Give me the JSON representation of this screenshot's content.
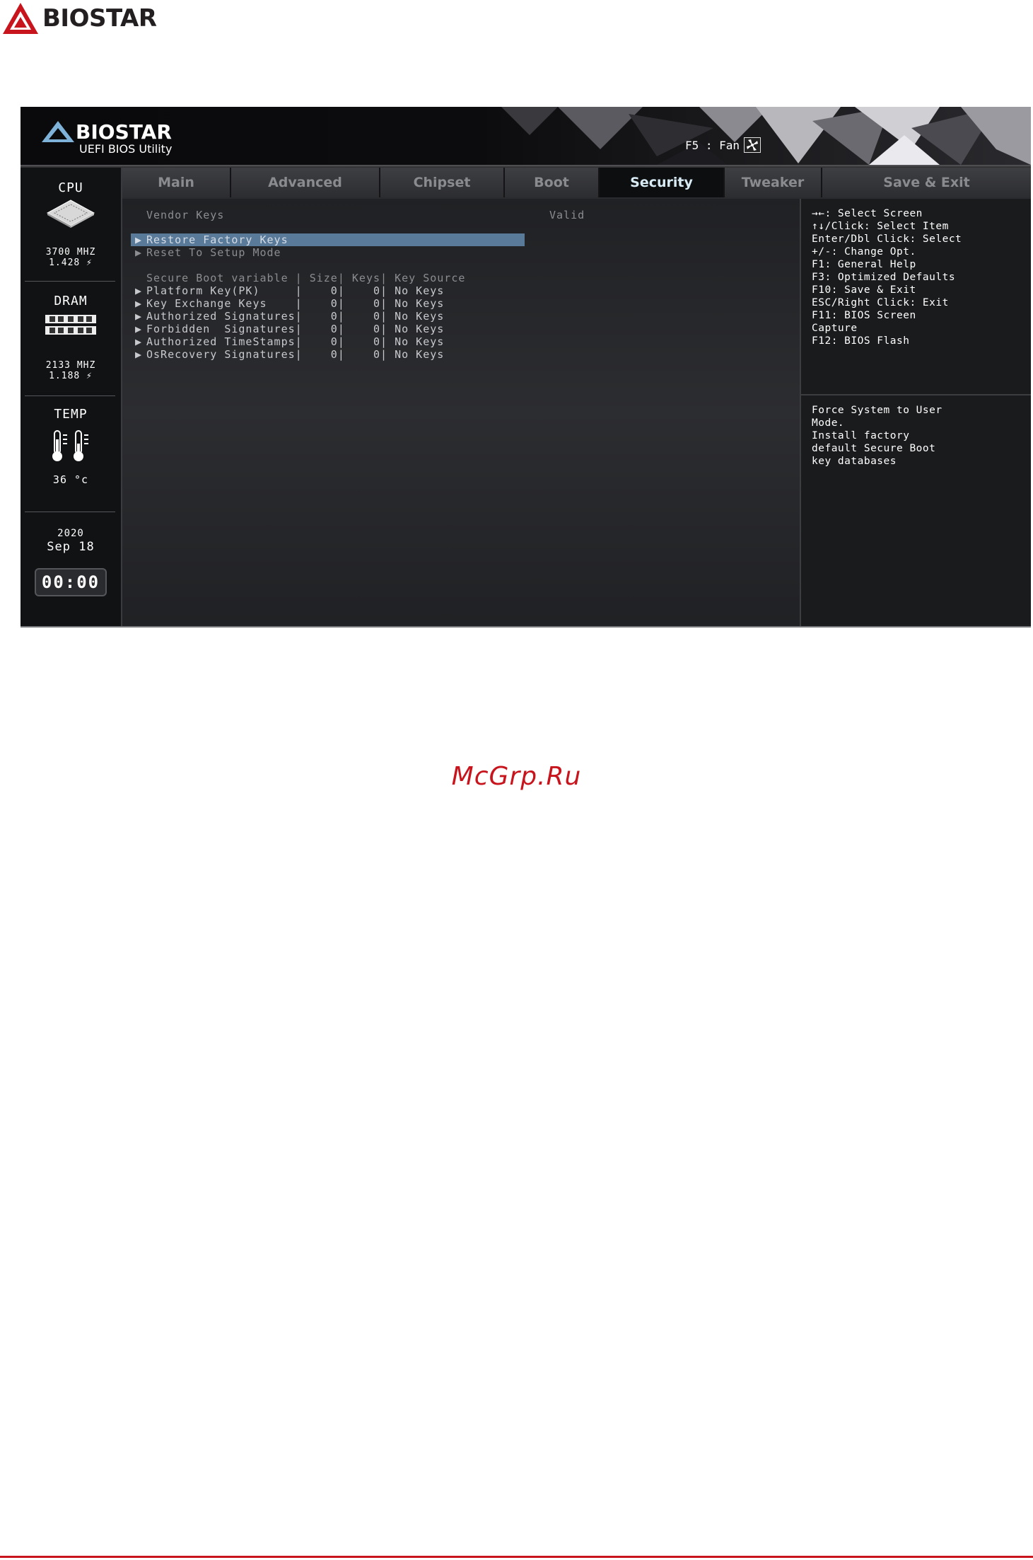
{
  "page": {
    "brand": "BIOSTAR",
    "watermark": "McGrp.Ru"
  },
  "bios": {
    "header": {
      "brand": "BIOSTAR",
      "subtitle": "UEFI BIOS Utility",
      "f5_label": "F5 : Fan"
    },
    "side": {
      "cpu_title": "CPU",
      "cpu_freq": "3700 MHZ",
      "cpu_volt": "1.428 ⚡",
      "dram_title": "DRAM",
      "dram_freq": "2133 MHZ",
      "dram_volt": "1.188 ⚡",
      "temp_title": "TEMP",
      "temp_value": "36 °c",
      "year": "2020",
      "date": "Sep  18",
      "time": "00:00"
    },
    "tabs": [
      {
        "label": "Main"
      },
      {
        "label": "Advanced"
      },
      {
        "label": "Chipset"
      },
      {
        "label": "Boot"
      },
      {
        "label": "Security"
      },
      {
        "label": "Tweaker"
      },
      {
        "label": "Save & Exit"
      }
    ],
    "content": {
      "vendor_keys_label": "Vendor Keys",
      "vendor_keys_value": "Valid",
      "restore_factory_keys": "Restore Factory Keys",
      "reset_setup_mode": "Reset To Setup Mode",
      "table_header": "Secure Boot variable | Size| Keys| Key Source",
      "rows": [
        "Platform Key(PK)     |    0|    0| No Keys",
        "Key Exchange Keys    |    0|    0| No Keys",
        "Authorized Signatures|    0|    0| No Keys",
        "Forbidden  Signatures|    0|    0| No Keys",
        "Authorized TimeStamps|    0|    0| No Keys",
        "OsRecovery Signatures|    0|    0| No Keys"
      ]
    },
    "help": {
      "keys": [
        "→←: Select Screen",
        "↑↓/Click: Select Item",
        "Enter/Dbl Click: Select",
        "+/-: Change Opt.",
        "F1: General Help",
        "F3: Optimized Defaults",
        "F10: Save & Exit",
        "ESC/Right Click: Exit",
        "F11: BIOS Screen",
        "Capture",
        "F12: BIOS Flash"
      ],
      "description": [
        "Force System to User",
        "Mode.",
        "Install factory",
        "default Secure Boot",
        "key databases"
      ]
    }
  }
}
